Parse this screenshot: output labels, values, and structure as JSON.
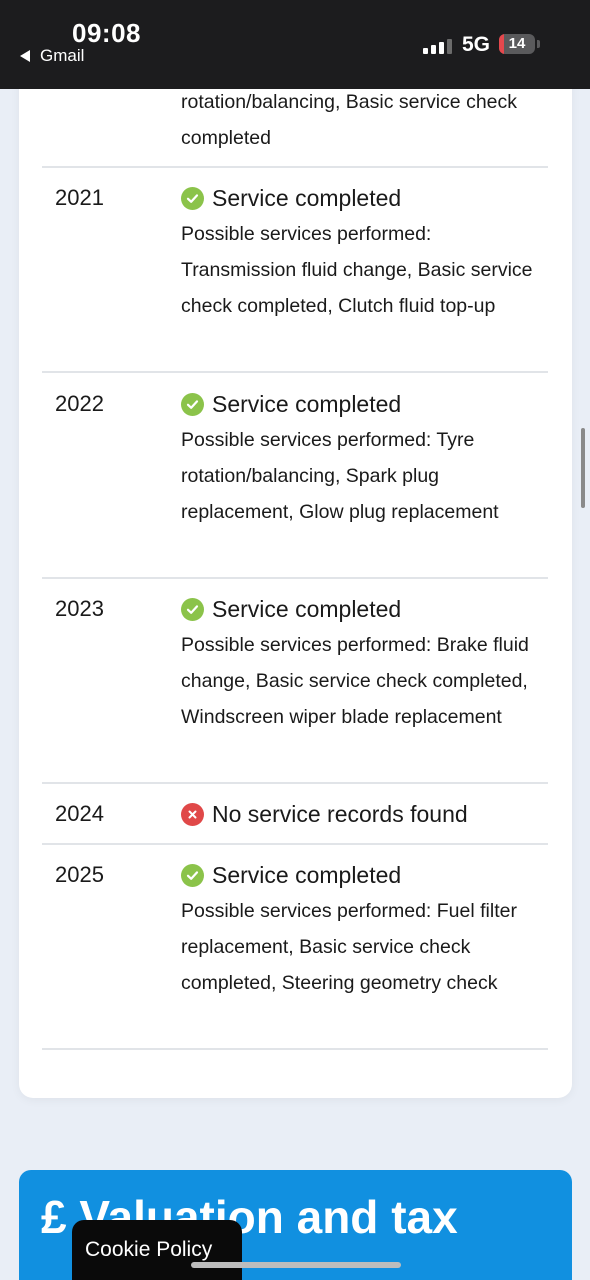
{
  "status_bar": {
    "time": "09:08",
    "back_app": "Gmail",
    "network": "5G",
    "battery": "14",
    "battery_level": 0.14,
    "battery_color": "#e5484d"
  },
  "previous_row_tail": "rotation/balancing, Basic service check completed",
  "service_history": [
    {
      "year": "2021",
      "status": "Service completed",
      "ok": true,
      "description": "Possible services performed: Transmission fluid change, Basic service check completed, Clutch fluid top-up"
    },
    {
      "year": "2022",
      "status": "Service completed",
      "ok": true,
      "description": "Possible services performed: Tyre rotation/balancing, Spark plug replacement, Glow plug replacement"
    },
    {
      "year": "2023",
      "status": "Service completed",
      "ok": true,
      "description": "Possible services performed: Brake fluid change, Basic service check completed, Windscreen wiper blade replacement"
    },
    {
      "year": "2024",
      "status": "No service records found",
      "ok": false,
      "description": ""
    },
    {
      "year": "2025",
      "status": "Service completed",
      "ok": true,
      "description": "Possible services performed: Fuel filter replacement, Basic service check completed, Steering geometry check"
    }
  ],
  "valuation": {
    "title": "£ Valuation and tax"
  },
  "cookie": {
    "label": "Cookie Policy"
  },
  "colors": {
    "ok": "#8bc34a",
    "bad": "#e04848",
    "accent": "#1190e0"
  }
}
